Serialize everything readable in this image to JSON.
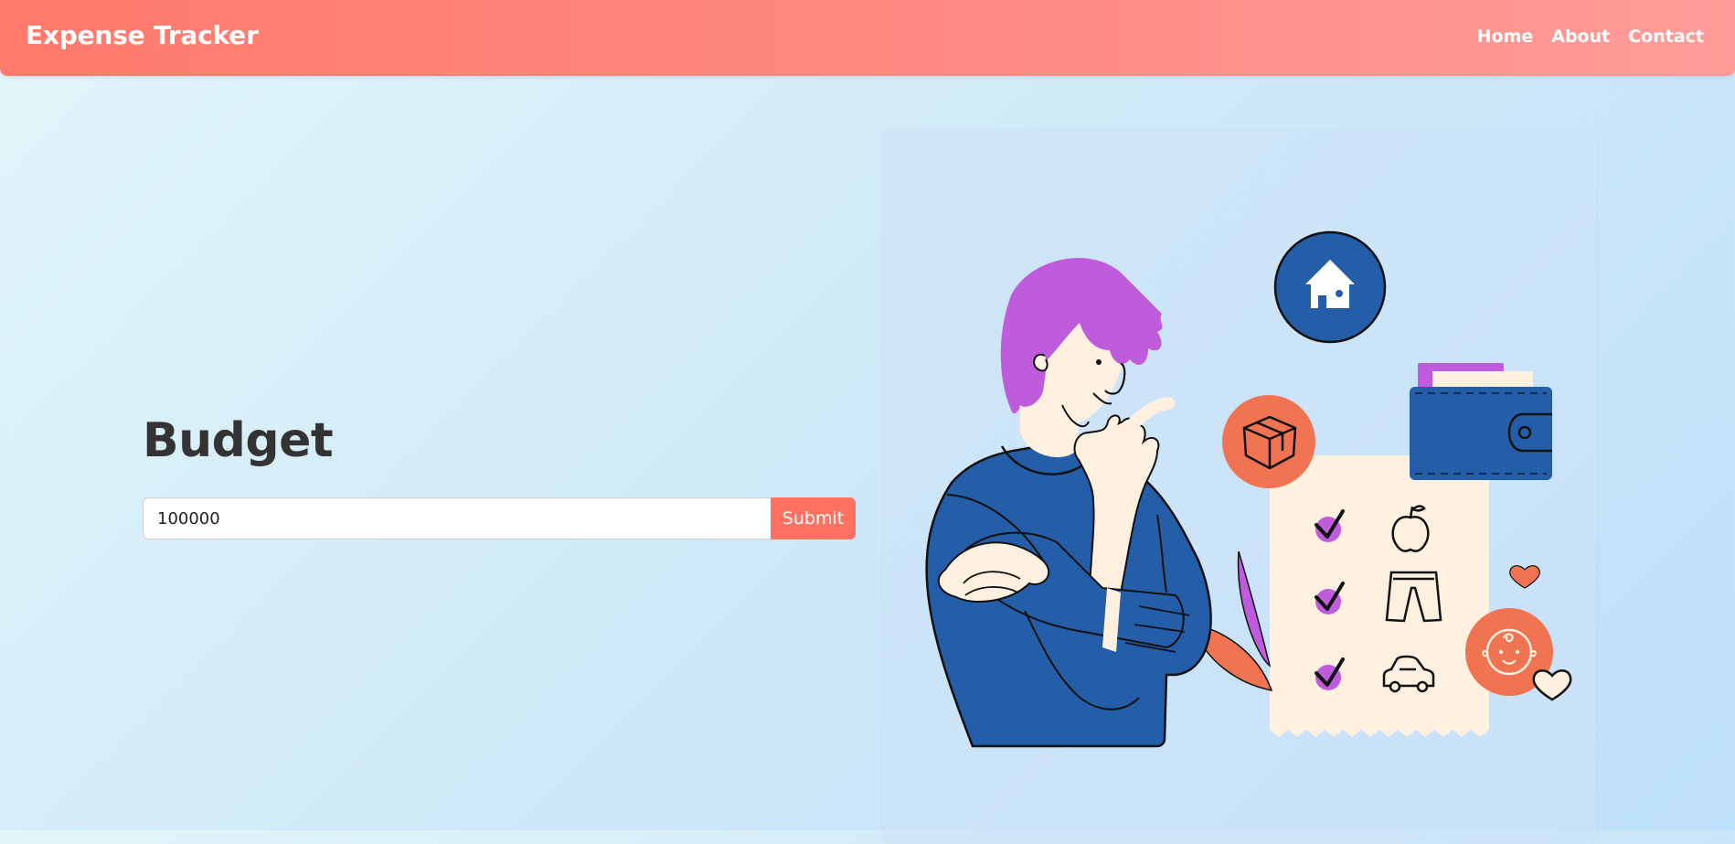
{
  "navbar": {
    "brand": "Expense Tracker",
    "links": [
      {
        "label": "Home"
      },
      {
        "label": "About"
      },
      {
        "label": "Contact"
      }
    ],
    "color": "#ff7a6c"
  },
  "budget": {
    "title": "Budget",
    "input_value": "100000",
    "submit_label": "Submit",
    "accent": "#ff7262"
  },
  "illustration": {
    "icons": [
      "house-icon",
      "box-icon",
      "wallet-icon",
      "apple-icon",
      "shorts-icon",
      "car-icon",
      "baby-icon",
      "heart-icon",
      "check-icon"
    ]
  }
}
